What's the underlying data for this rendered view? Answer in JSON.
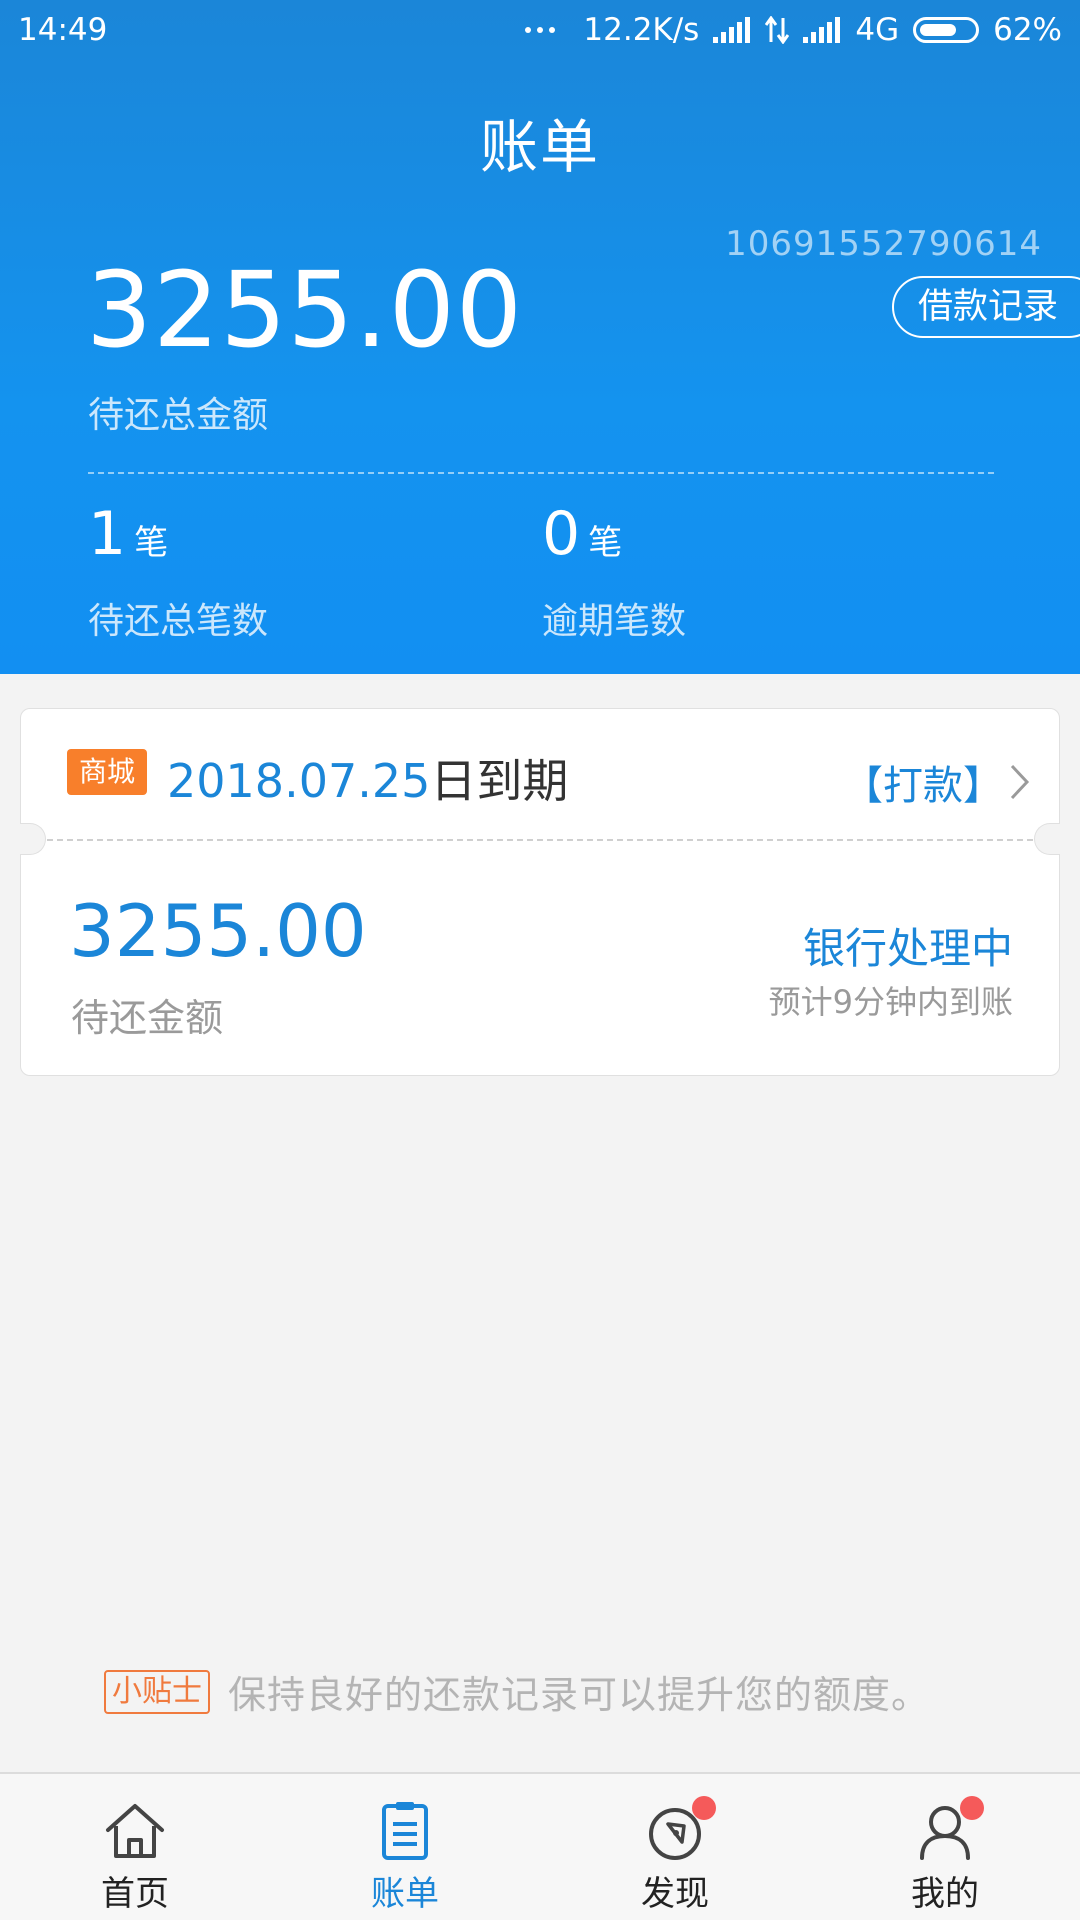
{
  "status_bar": {
    "time": "14:49",
    "net_speed": "12.2K/s",
    "network": "4G",
    "battery": "62%"
  },
  "header": {
    "title": "账单",
    "account_id": "10691552790614",
    "loan_record_label": "借款记录",
    "total_amount": "3255.00",
    "total_amount_label": "待还总金额",
    "stats": [
      {
        "number": "1",
        "unit": "笔",
        "label": "待还总笔数"
      },
      {
        "number": "0",
        "unit": "笔",
        "label": "逾期笔数"
      }
    ]
  },
  "bill": {
    "tag": "商城",
    "due_date": "2018.07.25",
    "due_suffix": "日到期",
    "pay_label": "【打款】",
    "amount": "3255.00",
    "amount_label": "待还金额",
    "status": "银行处理中",
    "eta": "预计9分钟内到账"
  },
  "tip": {
    "badge": "小贴士",
    "text": "保持良好的还款记录可以提升您的额度。"
  },
  "nav": {
    "items": [
      {
        "label": "首页",
        "icon": "home-icon"
      },
      {
        "label": "账单",
        "icon": "bill-icon"
      },
      {
        "label": "发现",
        "icon": "compass-icon"
      },
      {
        "label": "我的",
        "icon": "user-icon"
      }
    ]
  },
  "colors": {
    "brand_blue": "#1b86d8",
    "mall_orange": "#f87f2b",
    "badge_red": "#f55a5a"
  }
}
